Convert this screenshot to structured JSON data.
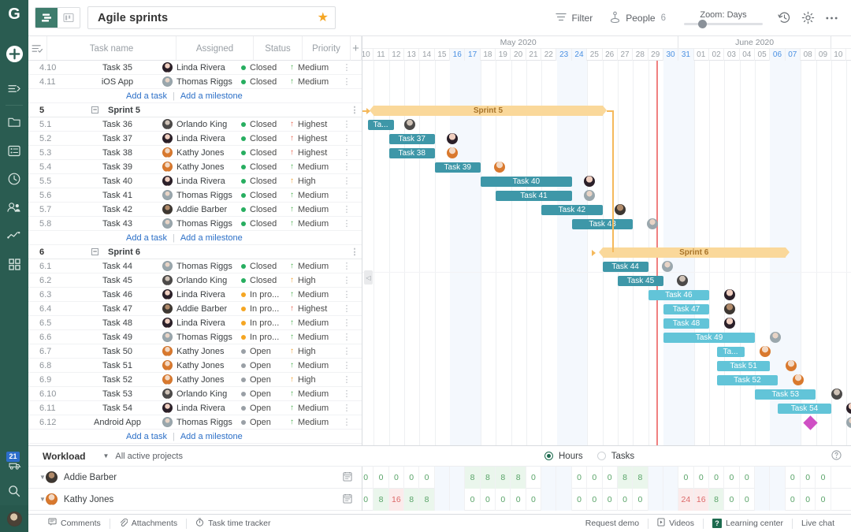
{
  "app": {
    "logo_letter": "G",
    "rail_icons": [
      "plus-icon",
      "expand-menu-icon",
      "folder-icon",
      "list-icon",
      "clock-icon",
      "people-icon",
      "trend-chart-icon",
      "grid-icon"
    ],
    "notification_count": "21",
    "search_icon": "search-icon"
  },
  "toolbar": {
    "view_gantt": "gantt-view",
    "view_board": "board-view",
    "project_title": "Agile sprints",
    "favorite_icon": "★",
    "filter_label": "Filter",
    "people_label": "People",
    "people_count": "6",
    "zoom_label": "Zoom: Days",
    "history_icon": "history-icon",
    "settings_icon": "gear-icon",
    "more_icon": "more-icon"
  },
  "grid": {
    "columns": [
      "",
      "",
      "Task name",
      "Assigned",
      "Status",
      "Priority",
      "+"
    ],
    "col_task_name": "Task name",
    "col_assigned": "Assigned",
    "col_status": "Status",
    "col_priority": "Priority",
    "add_task": "Add a task",
    "add_milestone": "Add a milestone",
    "divider": "|"
  },
  "rows": [
    {
      "kind": "task",
      "id": "4.10",
      "name": "Task 35",
      "assignee": "Linda Rivera",
      "av": "linda",
      "status": "Closed",
      "st_color": "#27ae60",
      "priority": "Medium",
      "pr_color": "#4caf50"
    },
    {
      "kind": "task",
      "id": "4.11",
      "name": "iOS App",
      "assignee": "Thomas Riggs",
      "av": "thomas",
      "status": "Closed",
      "st_color": "#27ae60",
      "priority": "Medium",
      "pr_color": "#4caf50"
    },
    {
      "kind": "add"
    },
    {
      "kind": "group",
      "id": "5",
      "name": "Sprint 5"
    },
    {
      "kind": "task",
      "id": "5.1",
      "name": "Task 36",
      "assignee": "Orlando King",
      "av": "orlando",
      "status": "Closed",
      "st_color": "#27ae60",
      "priority": "Highest",
      "pr_color": "#e8604c"
    },
    {
      "kind": "task",
      "id": "5.2",
      "name": "Task 37",
      "assignee": "Linda Rivera",
      "av": "linda",
      "status": "Closed",
      "st_color": "#27ae60",
      "priority": "Highest",
      "pr_color": "#e8604c"
    },
    {
      "kind": "task",
      "id": "5.3",
      "name": "Task 38",
      "assignee": "Kathy Jones",
      "av": "kathy",
      "status": "Closed",
      "st_color": "#27ae60",
      "priority": "Highest",
      "pr_color": "#e8604c"
    },
    {
      "kind": "task",
      "id": "5.4",
      "name": "Task 39",
      "assignee": "Kathy Jones",
      "av": "kathy",
      "status": "Closed",
      "st_color": "#27ae60",
      "priority": "Medium",
      "pr_color": "#4caf50"
    },
    {
      "kind": "task",
      "id": "5.5",
      "name": "Task 40",
      "assignee": "Linda Rivera",
      "av": "linda",
      "status": "Closed",
      "st_color": "#27ae60",
      "priority": "High",
      "pr_color": "#f0a030"
    },
    {
      "kind": "task",
      "id": "5.6",
      "name": "Task 41",
      "assignee": "Thomas Riggs",
      "av": "thomas",
      "status": "Closed",
      "st_color": "#27ae60",
      "priority": "Medium",
      "pr_color": "#4caf50"
    },
    {
      "kind": "task",
      "id": "5.7",
      "name": "Task 42",
      "assignee": "Addie Barber",
      "av": "addie",
      "status": "Closed",
      "st_color": "#27ae60",
      "priority": "Medium",
      "pr_color": "#4caf50"
    },
    {
      "kind": "task",
      "id": "5.8",
      "name": "Task 43",
      "assignee": "Thomas Riggs",
      "av": "thomas",
      "status": "Closed",
      "st_color": "#27ae60",
      "priority": "Medium",
      "pr_color": "#4caf50"
    },
    {
      "kind": "add"
    },
    {
      "kind": "group",
      "id": "6",
      "name": "Sprint 6"
    },
    {
      "kind": "task",
      "id": "6.1",
      "name": "Task 44",
      "assignee": "Thomas Riggs",
      "av": "thomas",
      "status": "Closed",
      "st_color": "#27ae60",
      "priority": "Medium",
      "pr_color": "#4caf50"
    },
    {
      "kind": "task",
      "id": "6.2",
      "name": "Task 45",
      "assignee": "Orlando King",
      "av": "orlando",
      "status": "Closed",
      "st_color": "#27ae60",
      "priority": "High",
      "pr_color": "#f0a030"
    },
    {
      "kind": "task",
      "id": "6.3",
      "name": "Task 46",
      "assignee": "Linda Rivera",
      "av": "linda",
      "status": "In pro...",
      "st_color": "#f5a623",
      "priority": "Medium",
      "pr_color": "#4caf50"
    },
    {
      "kind": "task",
      "id": "6.4",
      "name": "Task 47",
      "assignee": "Addie Barber",
      "av": "addie",
      "status": "In pro...",
      "st_color": "#f5a623",
      "priority": "Highest",
      "pr_color": "#e8604c"
    },
    {
      "kind": "task",
      "id": "6.5",
      "name": "Task 48",
      "assignee": "Linda Rivera",
      "av": "linda",
      "status": "In pro...",
      "st_color": "#f5a623",
      "priority": "Medium",
      "pr_color": "#4caf50"
    },
    {
      "kind": "task",
      "id": "6.6",
      "name": "Task 49",
      "assignee": "Thomas Riggs",
      "av": "thomas",
      "status": "In pro...",
      "st_color": "#f5a623",
      "priority": "Medium",
      "pr_color": "#4caf50"
    },
    {
      "kind": "task",
      "id": "6.7",
      "name": "Task 50",
      "assignee": "Kathy Jones",
      "av": "kathy",
      "status": "Open",
      "st_color": "#9aa0a6",
      "priority": "High",
      "pr_color": "#f0a030"
    },
    {
      "kind": "task",
      "id": "6.8",
      "name": "Task 51",
      "assignee": "Kathy Jones",
      "av": "kathy",
      "status": "Open",
      "st_color": "#9aa0a6",
      "priority": "Medium",
      "pr_color": "#4caf50"
    },
    {
      "kind": "task",
      "id": "6.9",
      "name": "Task 52",
      "assignee": "Kathy Jones",
      "av": "kathy",
      "status": "Open",
      "st_color": "#9aa0a6",
      "priority": "High",
      "pr_color": "#f0a030"
    },
    {
      "kind": "task",
      "id": "6.10",
      "name": "Task 53",
      "assignee": "Orlando King",
      "av": "orlando",
      "status": "Open",
      "st_color": "#9aa0a6",
      "priority": "Medium",
      "pr_color": "#4caf50"
    },
    {
      "kind": "task",
      "id": "6.11",
      "name": "Task 54",
      "assignee": "Linda Rivera",
      "av": "linda",
      "status": "Open",
      "st_color": "#9aa0a6",
      "priority": "Medium",
      "pr_color": "#4caf50"
    },
    {
      "kind": "task",
      "id": "6.12",
      "name": "Android App",
      "assignee": "Thomas Riggs",
      "av": "thomas",
      "status": "Open",
      "st_color": "#9aa0a6",
      "priority": "Medium",
      "pr_color": "#4caf50"
    },
    {
      "kind": "add"
    }
  ],
  "timeline": {
    "months": [
      {
        "label": "May 2020",
        "days": 21
      },
      {
        "label": "June 2020",
        "days": 10
      }
    ],
    "days": [
      "10",
      "11",
      "12",
      "13",
      "14",
      "15",
      "16",
      "17",
      "18",
      "19",
      "20",
      "21",
      "22",
      "23",
      "24",
      "25",
      "26",
      "27",
      "28",
      "29",
      "30",
      "31",
      "01",
      "02",
      "03",
      "04",
      "05",
      "06",
      "07",
      "08",
      "09",
      "10"
    ],
    "weekend_days": [
      "16",
      "17",
      "23",
      "24",
      "30",
      "31",
      "06",
      "07"
    ],
    "today_day": "29"
  },
  "gantt": {
    "sprint5_label": "Sprint 5",
    "sprint6_label": "Sprint 6",
    "sprint5": {
      "start": 11,
      "end": 26,
      "row": 3
    },
    "sprint6": {
      "start": 26,
      "end": 38,
      "row": 13
    },
    "bars": [
      {
        "row": 4,
        "label": "Ta...",
        "truncated": "Task 36",
        "start": 10.6,
        "end": 12.3,
        "type": "done"
      },
      {
        "row": 5,
        "label": "Task 37",
        "start": 12.0,
        "end": 15.0,
        "type": "done"
      },
      {
        "row": 6,
        "label": "Task 38",
        "start": 12.0,
        "end": 15.0,
        "type": "done"
      },
      {
        "row": 7,
        "label": "Task 39",
        "start": 15.0,
        "end": 18.0,
        "type": "done"
      },
      {
        "row": 8,
        "label": "Task 40",
        "start": 18.0,
        "end": 24.0,
        "type": "done"
      },
      {
        "row": 9,
        "label": "Task 41",
        "start": 19.0,
        "end": 24.0,
        "type": "done"
      },
      {
        "row": 10,
        "label": "Task 42",
        "start": 22.0,
        "end": 26.0,
        "type": "done"
      },
      {
        "row": 11,
        "label": "Task 43",
        "start": 24.0,
        "end": 28.0,
        "type": "done"
      },
      {
        "row": 14,
        "label": "Task 44",
        "start": 26.0,
        "end": 29.0,
        "type": "done"
      },
      {
        "row": 15,
        "label": "Task 45",
        "start": 27.0,
        "end": 30.0,
        "type": "done"
      },
      {
        "row": 16,
        "label": "Task 46",
        "start": 29.0,
        "end": 33.0,
        "type": "prog"
      },
      {
        "row": 17,
        "label": "Task 47",
        "start": 30.0,
        "end": 33.0,
        "type": "prog"
      },
      {
        "row": 18,
        "label": "Task 48",
        "start": 30.0,
        "end": 33.0,
        "type": "prog"
      },
      {
        "row": 19,
        "label": "Task 49",
        "start": 30.0,
        "end": 36.0,
        "type": "prog"
      },
      {
        "row": 20,
        "label": "Ta...",
        "truncated": "Task 50",
        "start": 33.5,
        "end": 35.3,
        "type": "prog"
      },
      {
        "row": 21,
        "label": "Task 51",
        "start": 33.5,
        "end": 37.0,
        "type": "prog"
      },
      {
        "row": 22,
        "label": "Task 52",
        "start": 33.5,
        "end": 37.5,
        "type": "prog"
      },
      {
        "row": 23,
        "label": "Task 53",
        "start": 36.0,
        "end": 40.0,
        "type": "prog"
      },
      {
        "row": 24,
        "label": "Task 54",
        "start": 37.5,
        "end": 41.0,
        "type": "prog"
      }
    ],
    "row_avatars": [
      {
        "row": 4,
        "av": "orlando",
        "day": 13.0
      },
      {
        "row": 5,
        "av": "linda",
        "day": 15.8
      },
      {
        "row": 6,
        "av": "kathy",
        "day": 15.8
      },
      {
        "row": 7,
        "av": "kathy",
        "day": 18.9
      },
      {
        "row": 8,
        "av": "linda",
        "day": 24.8
      },
      {
        "row": 9,
        "av": "thomas",
        "day": 24.8
      },
      {
        "row": 10,
        "av": "addie",
        "day": 26.8
      },
      {
        "row": 11,
        "av": "thomas",
        "day": 28.9
      },
      {
        "row": 14,
        "av": "thomas",
        "day": 29.9
      },
      {
        "row": 15,
        "av": "orlando",
        "day": 30.9
      },
      {
        "row": 16,
        "av": "linda",
        "day": 34.0
      },
      {
        "row": 17,
        "av": "addie",
        "day": 34.0
      },
      {
        "row": 18,
        "av": "linda",
        "day": 34.0
      },
      {
        "row": 19,
        "av": "thomas",
        "day": 37.0
      },
      {
        "row": 20,
        "av": "kathy",
        "day": 36.3
      },
      {
        "row": 21,
        "av": "kathy",
        "day": 38.0
      },
      {
        "row": 22,
        "av": "kathy",
        "day": 38.5
      },
      {
        "row": 23,
        "av": "orlando",
        "day": 41.0
      },
      {
        "row": 24,
        "av": "linda",
        "day": 42.0
      }
    ],
    "milestone": {
      "row": 25,
      "day": 39.3,
      "color": "#cf4fc4",
      "name": "milestone-diamond"
    },
    "milestone_avatar": {
      "row": 25,
      "av": "thomas",
      "day": 42.0
    },
    "deadline_flame": {
      "row": 25,
      "day": 46.5,
      "color": "#e8503a",
      "name": "deadline-flame-icon"
    }
  },
  "workload": {
    "title": "Workload",
    "project_filter": "All active projects",
    "radio_hours": "Hours",
    "radio_tasks": "Tasks",
    "selected_mode": "Hours",
    "help_icon": "help-icon",
    "people": [
      {
        "name": "Addie Barber",
        "av": "addie",
        "values": [
          "0",
          "0",
          "0",
          "0",
          "0",
          "",
          "",
          "8",
          "8",
          "8",
          "8",
          "0",
          "",
          "",
          "0",
          "0",
          "0",
          "8",
          "8",
          "",
          "",
          "0",
          "0",
          "0",
          "0",
          "0",
          "",
          "",
          "0",
          "0",
          "0"
        ]
      },
      {
        "name": "Kathy Jones",
        "av": "kathy",
        "values": [
          "0",
          "8",
          "16",
          "8",
          "8",
          "",
          "",
          "0",
          "0",
          "0",
          "0",
          "0",
          "",
          "",
          "0",
          "0",
          "0",
          "0",
          "0",
          "",
          "",
          "24",
          "16",
          "8",
          "0",
          "0",
          "",
          "",
          "0",
          "0",
          "0"
        ]
      }
    ]
  },
  "bottombar": {
    "comments": "Comments",
    "attachments": "Attachments",
    "time_tracker": "Task time tracker",
    "request_demo": "Request demo",
    "videos": "Videos",
    "learning_center": "Learning center",
    "live_chat": "Live chat"
  }
}
